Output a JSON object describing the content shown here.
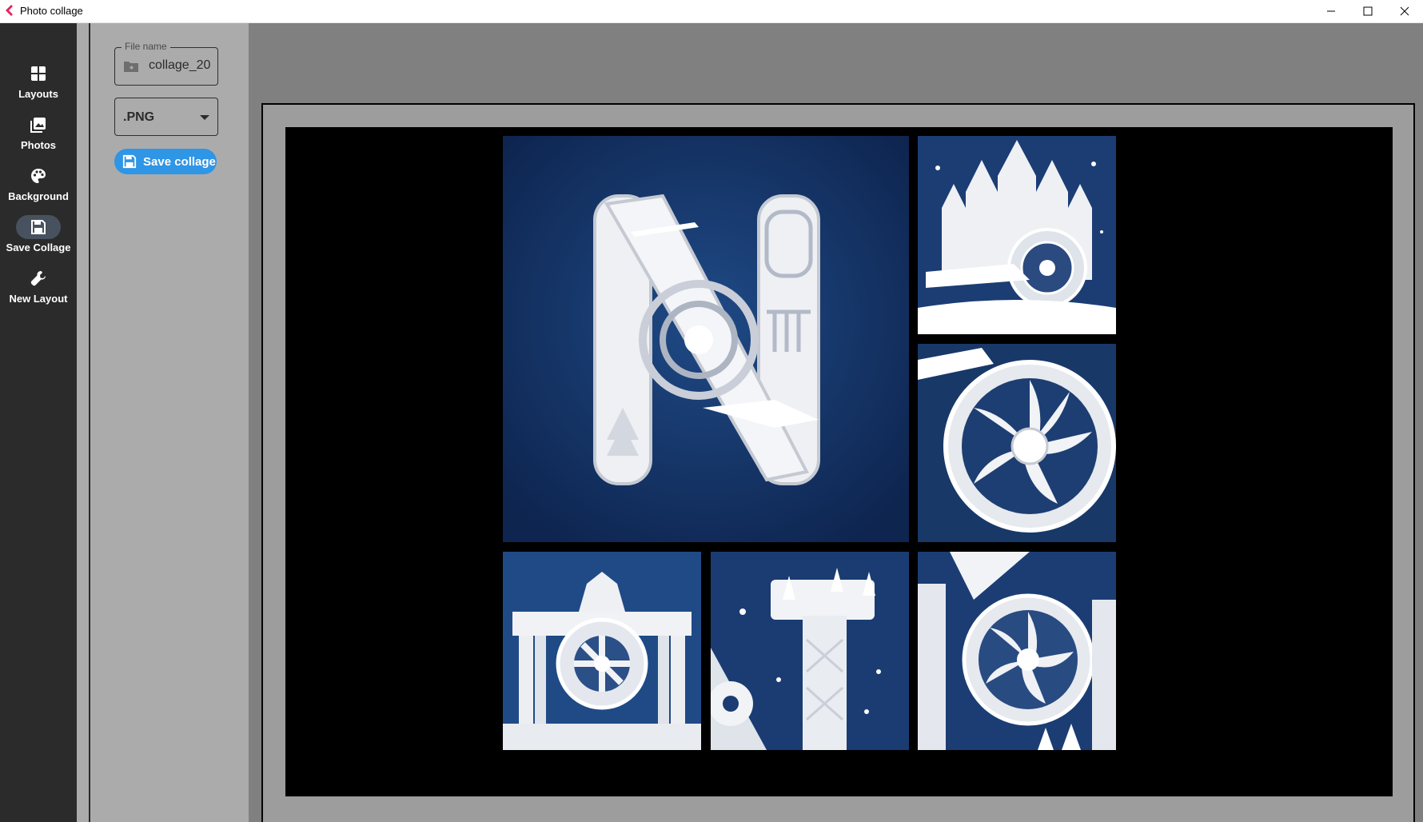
{
  "window": {
    "title": "Photo collage",
    "controls": [
      "minimize",
      "maximize",
      "close"
    ]
  },
  "sidebar": {
    "items": [
      {
        "label": "Layouts",
        "icon": "layouts-icon",
        "active": false
      },
      {
        "label": "Photos",
        "icon": "photos-icon",
        "active": false
      },
      {
        "label": "Background",
        "icon": "palette-icon",
        "active": false
      },
      {
        "label": "Save Collage",
        "icon": "save-icon",
        "active": true
      },
      {
        "label": "New Layout",
        "icon": "wrench-icon",
        "active": false
      }
    ]
  },
  "save_panel": {
    "file_name_label": "File name",
    "file_name_value": "collage_20",
    "format_value": ".PNG",
    "save_button_label": "Save collage"
  },
  "colors": {
    "sidebar_bg": "#2b2b2b",
    "panel_bg": "#ababab",
    "preview_bg": "#808080",
    "canvas_bg": "#000000",
    "accent": "#2f95e5",
    "tile_blue": "#173869"
  },
  "collage": {
    "photos": [
      {
        "subject": "paper-cut letter N with airplanes and turbine"
      },
      {
        "subject": "paper-cut winter castle with turbine"
      },
      {
        "subject": "paper-cut turbine fan close-up"
      },
      {
        "subject": "paper-cut Brandenburg gate with turbine"
      },
      {
        "subject": "paper-cut letter T with snowflakes"
      },
      {
        "subject": "paper-cut turbine with buildings"
      }
    ]
  }
}
